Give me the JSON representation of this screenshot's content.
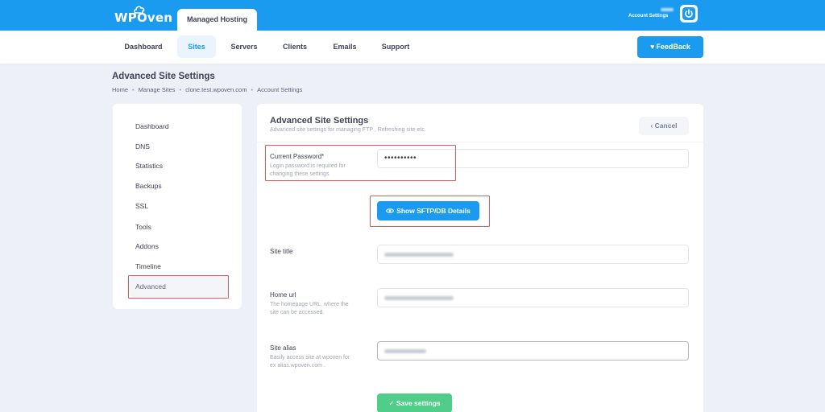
{
  "brand": {
    "logo_text": "WPOven"
  },
  "topbar": {
    "tab_label": "Managed Hosting",
    "account_label": "Account Settings"
  },
  "nav": {
    "items": [
      {
        "label": "Dashboard"
      },
      {
        "label": "Sites"
      },
      {
        "label": "Servers"
      },
      {
        "label": "Clients"
      },
      {
        "label": "Emails"
      },
      {
        "label": "Support"
      }
    ],
    "active": "Sites",
    "feedback_label": "FeedBack"
  },
  "page": {
    "title": "Advanced Site Settings",
    "breadcrumb": [
      "Home",
      "Manage Sites",
      "clone.test.wpoven.com",
      "Account Settings"
    ]
  },
  "sidebar": {
    "items": [
      {
        "label": "Dashboard"
      },
      {
        "label": "DNS"
      },
      {
        "label": "Statistics"
      },
      {
        "label": "Backups"
      },
      {
        "label": "SSL"
      },
      {
        "label": "Tools"
      },
      {
        "label": "Addons"
      },
      {
        "label": "Timeline"
      },
      {
        "label": "Advanced"
      }
    ],
    "active": "Advanced"
  },
  "panel": {
    "title": "Advanced Site Settings",
    "subtitle": "Advanced site settings for managing FTP , Refreshing site etc.",
    "cancel_label": "Cancel",
    "password": {
      "label": "Current Password*",
      "help_line1": "Login password is required for",
      "help_line2": "changing these settings",
      "value": "••••••••••"
    },
    "show_button_label": "Show SFTP/DB Details",
    "site_title": {
      "label": "Site title"
    },
    "home_url": {
      "label": "Home url",
      "help_line1": "The homepage URL, where the",
      "help_line2": "site can be accessed."
    },
    "site_alias": {
      "label": "Site alias",
      "help_line1": "Easily access site at wpoven for",
      "help_line2": "ex alias.wpoven.com ."
    },
    "save_label": "Save settings"
  },
  "colors": {
    "primary": "#1a9bf0",
    "success": "#50cd89",
    "highlight": "#e05a5a",
    "background": "#eef0f8"
  }
}
